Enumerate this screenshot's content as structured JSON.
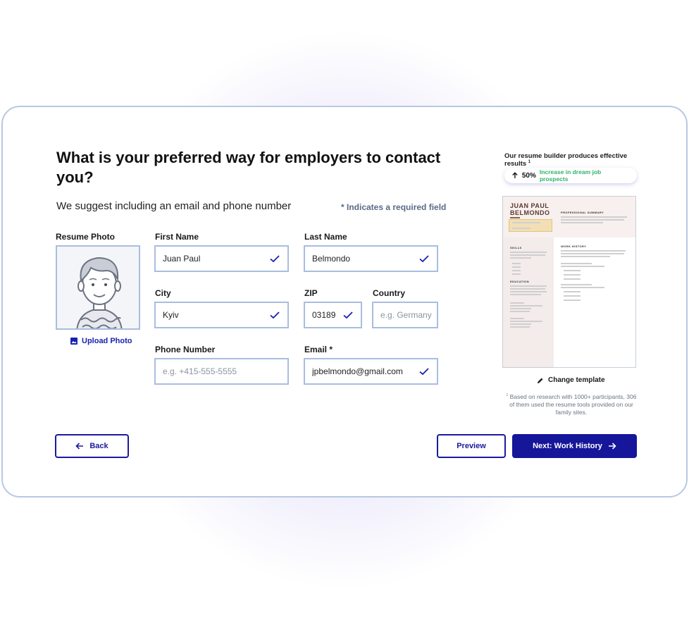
{
  "form": {
    "title": "What is your preferred way for employers to contact you?",
    "subtitle": "We suggest including an email and phone number",
    "required_note": "* Indicates a required field",
    "photo": {
      "label": "Resume Photo",
      "upload_label": "Upload Photo"
    },
    "fields": {
      "first_name": {
        "label": "First Name",
        "value": "Juan Paul",
        "valid": true
      },
      "last_name": {
        "label": "Last Name",
        "value": "Belmondo",
        "valid": true
      },
      "city": {
        "label": "City",
        "value": "Kyiv",
        "valid": true
      },
      "zip": {
        "label": "ZIP",
        "value": "03189",
        "valid": true
      },
      "country": {
        "label": "Country",
        "value": "",
        "placeholder": "e.g. Germany"
      },
      "phone": {
        "label": "Phone Number",
        "value": "",
        "placeholder": "e.g. +415-555-5555"
      },
      "email": {
        "label": "Email *",
        "value": "jpbelmondo@gmail.com",
        "valid": true
      }
    }
  },
  "sidebar": {
    "heading": "Our resume builder produces effective results",
    "heading_sup": "1",
    "stat": {
      "value": "50%",
      "text": "Increase in dream job prospects",
      "icon": "arrow-up-icon"
    },
    "resume_preview": {
      "name_line1": "JUAN PAUL",
      "name_line2": "BELMONDO",
      "sections": [
        "PROFESSIONAL SUMMARY",
        "SKILLS",
        "EDUCATION",
        "WORK HISTORY"
      ]
    },
    "change_template_label": "Change template",
    "footnote_sup": "1",
    "footnote": "Based on research with 1000+ participants, 306 of them used the resume tools provided on our family sites."
  },
  "nav": {
    "back_label": "Back",
    "preview_label": "Preview",
    "next_label": "Next: Work History"
  },
  "colors": {
    "accent": "#16169a",
    "field_border": "#a9bde0",
    "success": "#2fb36a",
    "card_border": "#b9c8e3"
  }
}
